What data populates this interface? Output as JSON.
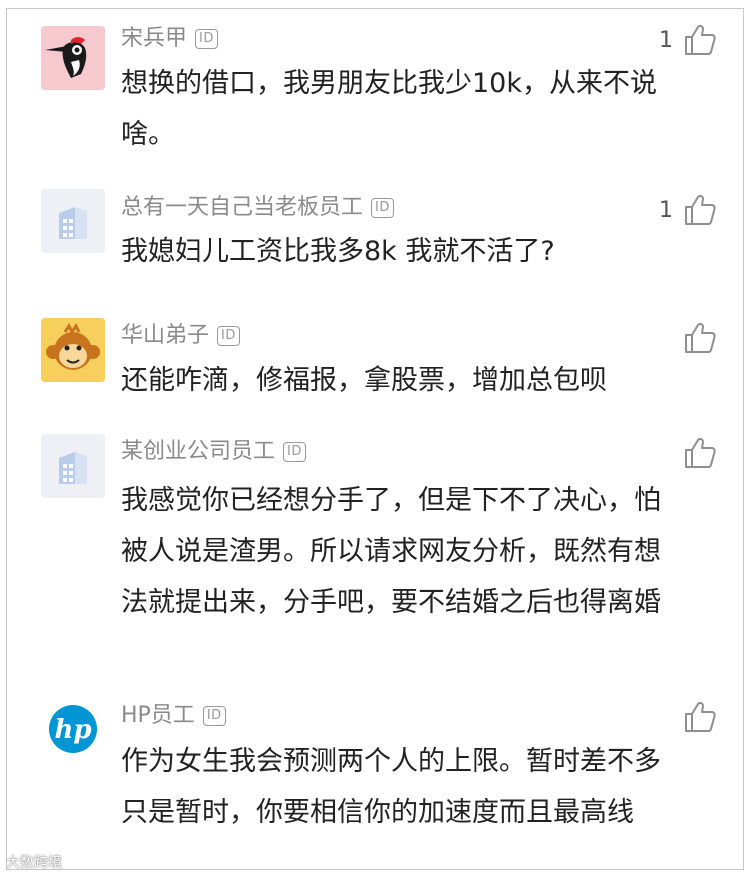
{
  "id_badge_label": "ID",
  "colors": {
    "author": "#8a8a8a",
    "body_text": "#222222",
    "woodpecker_bg": "#f6c9cf",
    "building_bg": "#eef0f6",
    "monkey_bg": "#f6cf5c",
    "hp_blue": "#0096d6"
  },
  "comments": [
    {
      "author": "宋兵甲",
      "avatar_icon": "woodpecker-icon",
      "text": "想换的借口，我男朋友比我少10k，从来不说啥。",
      "likes": "1"
    },
    {
      "author": "总有一天自己当老板员工",
      "avatar_icon": "building-icon",
      "text": "我媳妇儿工资比我多8k  我就不活了?",
      "likes": "1"
    },
    {
      "author": "华山弟子",
      "avatar_icon": "monkey-icon",
      "text": "还能咋滴，修福报，拿股票，增加总包呗",
      "likes": ""
    },
    {
      "author": "某创业公司员工",
      "avatar_icon": "building-icon",
      "text": "我感觉你已经想分手了，但是下不了决心，怕被人说是渣男。所以请求网友分析，既然有想法就提出来，分手吧，要不结婚之后也得离婚",
      "likes": ""
    },
    {
      "author": "HP员工",
      "avatar_icon": "hp-logo-icon",
      "text": "作为女生我会预测两个人的上限。暂时差不多只是暂时，你要相信你的加速度而且最高线",
      "likes": ""
    }
  ],
  "watermark": "大数跨境"
}
